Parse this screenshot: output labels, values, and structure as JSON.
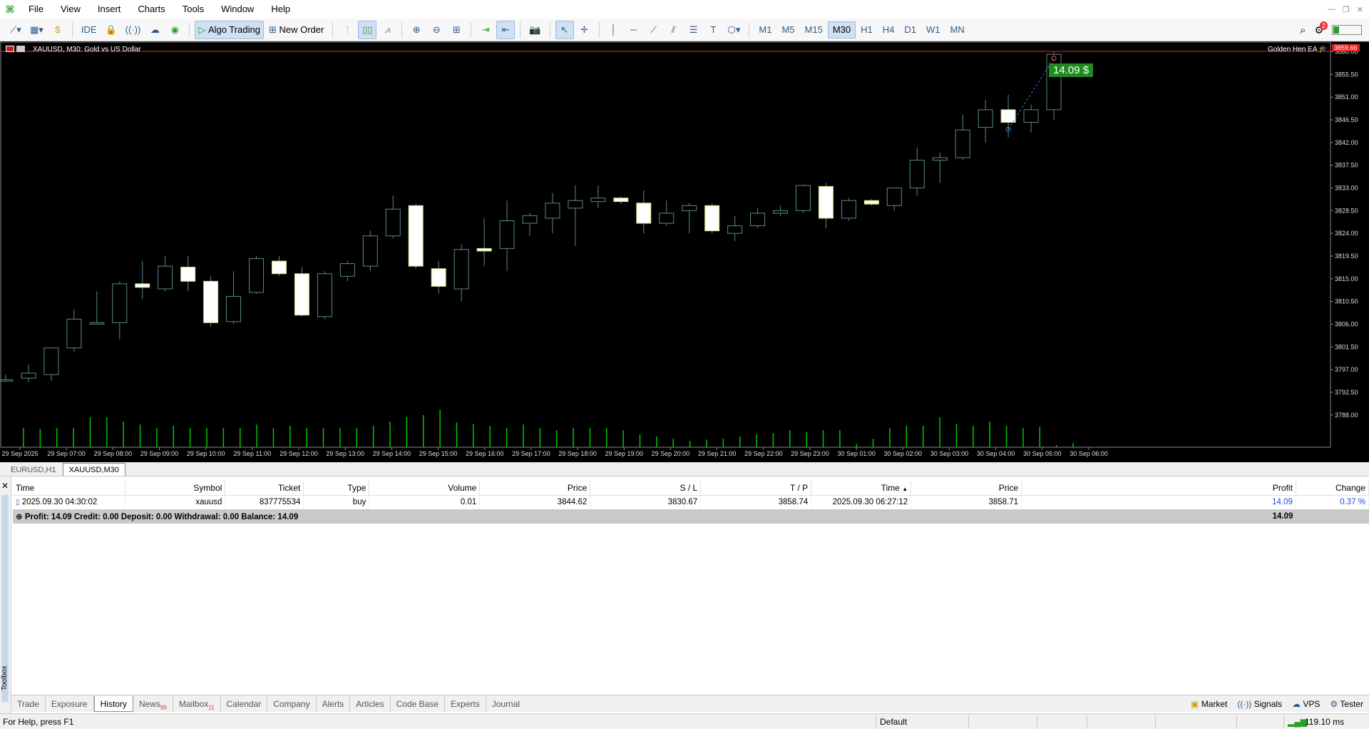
{
  "menubar": {
    "items": [
      "File",
      "View",
      "Insert",
      "Charts",
      "Tools",
      "Window",
      "Help"
    ]
  },
  "toolbar": {
    "ide_label": "IDE",
    "algo_trading_label": "Algo Trading",
    "new_order_label": "New Order",
    "timeframes": [
      "M1",
      "M5",
      "M15",
      "M30",
      "H1",
      "H4",
      "D1",
      "W1",
      "MN"
    ],
    "active_timeframe": "M30",
    "notification_count": "2"
  },
  "chart": {
    "symbol_title": "XAUUSD, M30:  Gold vs US Dollar",
    "ea_name": "Golden Hen EA",
    "profit_label": "14.09 $",
    "current_price_label": "3859.66",
    "colors": {
      "background": "#000000",
      "bull_body": "#000000",
      "bear_body": "#ffffff",
      "candle_outline": "#5a8a8a",
      "volume": "#00c800",
      "price_line": "#ff2020",
      "profit_bg": "#1f8a1f"
    }
  },
  "chart_data": {
    "type": "candlestick",
    "title": "XAUUSD, M30:  Gold vs US Dollar",
    "y_ticks": [
      "3860.00",
      "3855.50",
      "3851.00",
      "3846.50",
      "3842.00",
      "3837.50",
      "3833.00",
      "3828.50",
      "3824.00",
      "3819.50",
      "3815.00",
      "3810.50",
      "3806.00",
      "3801.50",
      "3797.00",
      "3792.50",
      "3788.00"
    ],
    "ylim": [
      3785.0,
      3860.5
    ],
    "x_ticks": [
      "29 Sep 2025",
      "29 Sep 07:00",
      "29 Sep 08:00",
      "29 Sep 09:00",
      "29 Sep 10:00",
      "29 Sep 11:00",
      "29 Sep 12:00",
      "29 Sep 13:00",
      "29 Sep 14:00",
      "29 Sep 15:00",
      "29 Sep 16:00",
      "29 Sep 17:00",
      "29 Sep 18:00",
      "29 Sep 19:00",
      "29 Sep 20:00",
      "29 Sep 21:00",
      "29 Sep 22:00",
      "29 Sep 23:00",
      "30 Sep 01:00",
      "30 Sep 02:00",
      "30 Sep 03:00",
      "30 Sep 04:00",
      "30 Sep 05:00",
      "30 Sep 06:00"
    ],
    "candles": [
      {
        "o": 3795.0,
        "h": 3796.0,
        "l": 3794.5,
        "c": 3795.0
      },
      {
        "o": 3795.3,
        "h": 3798.0,
        "l": 3794.5,
        "c": 3796.3
      },
      {
        "o": 3796.0,
        "h": 3801.3,
        "l": 3794.8,
        "c": 3801.3
      },
      {
        "o": 3801.3,
        "h": 3809.0,
        "l": 3800.5,
        "c": 3807.0
      },
      {
        "o": 3806.3,
        "h": 3812.5,
        "l": 3806.0,
        "c": 3806.3
      },
      {
        "o": 3806.3,
        "h": 3814.5,
        "l": 3803.0,
        "c": 3814.0
      },
      {
        "o": 3814.0,
        "h": 3818.5,
        "l": 3811.0,
        "c": 3813.3
      },
      {
        "o": 3813.0,
        "h": 3819.5,
        "l": 3812.5,
        "c": 3817.5
      },
      {
        "o": 3817.3,
        "h": 3819.5,
        "l": 3812.5,
        "c": 3814.5
      },
      {
        "o": 3814.5,
        "h": 3815.5,
        "l": 3805.5,
        "c": 3806.3
      },
      {
        "o": 3806.5,
        "h": 3816.5,
        "l": 3806.0,
        "c": 3811.5
      },
      {
        "o": 3812.3,
        "h": 3819.5,
        "l": 3812.0,
        "c": 3819.0
      },
      {
        "o": 3818.5,
        "h": 3819.5,
        "l": 3815.5,
        "c": 3816.0
      },
      {
        "o": 3816.0,
        "h": 3817.3,
        "l": 3807.5,
        "c": 3807.8
      },
      {
        "o": 3807.5,
        "h": 3816.5,
        "l": 3807.0,
        "c": 3816.0
      },
      {
        "o": 3815.5,
        "h": 3818.5,
        "l": 3814.5,
        "c": 3818.0
      },
      {
        "o": 3817.5,
        "h": 3824.5,
        "l": 3816.5,
        "c": 3823.5
      },
      {
        "o": 3823.5,
        "h": 3831.5,
        "l": 3823.0,
        "c": 3828.8
      },
      {
        "o": 3829.5,
        "h": 3829.8,
        "l": 3817.0,
        "c": 3817.5
      },
      {
        "o": 3817.0,
        "h": 3818.5,
        "l": 3812.0,
        "c": 3813.5
      },
      {
        "o": 3813.0,
        "h": 3821.8,
        "l": 3810.5,
        "c": 3820.8
      },
      {
        "o": 3821.0,
        "h": 3827.0,
        "l": 3817.5,
        "c": 3820.5
      },
      {
        "o": 3821.0,
        "h": 3830.5,
        "l": 3816.5,
        "c": 3826.5
      },
      {
        "o": 3826.0,
        "h": 3828.0,
        "l": 3823.5,
        "c": 3827.5
      },
      {
        "o": 3827.0,
        "h": 3832.0,
        "l": 3824.0,
        "c": 3830.0
      },
      {
        "o": 3829.0,
        "h": 3833.5,
        "l": 3821.5,
        "c": 3830.5
      },
      {
        "o": 3830.3,
        "h": 3833.5,
        "l": 3829.0,
        "c": 3831.0
      },
      {
        "o": 3831.0,
        "h": 3831.3,
        "l": 3829.8,
        "c": 3830.3
      },
      {
        "o": 3830.0,
        "h": 3832.5,
        "l": 3824.0,
        "c": 3826.0
      },
      {
        "o": 3826.0,
        "h": 3830.5,
        "l": 3825.5,
        "c": 3828.0
      },
      {
        "o": 3828.5,
        "h": 3830.0,
        "l": 3824.0,
        "c": 3829.5
      },
      {
        "o": 3829.5,
        "h": 3830.0,
        "l": 3824.0,
        "c": 3824.5
      },
      {
        "o": 3824.0,
        "h": 3827.5,
        "l": 3822.5,
        "c": 3825.5
      },
      {
        "o": 3825.5,
        "h": 3829.0,
        "l": 3825.0,
        "c": 3828.0
      },
      {
        "o": 3828.0,
        "h": 3829.5,
        "l": 3827.5,
        "c": 3828.5
      },
      {
        "o": 3828.5,
        "h": 3833.7,
        "l": 3828.0,
        "c": 3833.5
      },
      {
        "o": 3833.3,
        "h": 3834.0,
        "l": 3825.0,
        "c": 3827.0
      },
      {
        "o": 3827.0,
        "h": 3831.0,
        "l": 3826.5,
        "c": 3830.5
      },
      {
        "o": 3830.5,
        "h": 3830.8,
        "l": 3829.5,
        "c": 3829.8
      },
      {
        "o": 3829.5,
        "h": 3833.0,
        "l": 3828.5,
        "c": 3833.0
      },
      {
        "o": 3833.0,
        "h": 3841.0,
        "l": 3831.5,
        "c": 3838.5
      },
      {
        "o": 3838.5,
        "h": 3840.0,
        "l": 3834.0,
        "c": 3839.0
      },
      {
        "o": 3839.0,
        "h": 3847.5,
        "l": 3838.5,
        "c": 3844.5
      },
      {
        "o": 3845.0,
        "h": 3850.5,
        "l": 3842.0,
        "c": 3848.5
      },
      {
        "o": 3848.5,
        "h": 3851.5,
        "l": 3843.0,
        "c": 3846.0
      },
      {
        "o": 3846.0,
        "h": 3849.5,
        "l": 3844.0,
        "c": 3848.5
      },
      {
        "o": 3848.5,
        "h": 3860.0,
        "l": 3846.5,
        "c": 3859.5
      }
    ],
    "volumes": [
      0.45,
      0.43,
      0.45,
      0.45,
      0.7,
      0.7,
      0.6,
      0.53,
      0.45,
      0.5,
      0.45,
      0.45,
      0.45,
      0.45,
      0.53,
      0.45,
      0.5,
      0.45,
      0.45,
      0.45,
      0.45,
      0.5,
      0.6,
      0.7,
      0.75,
      0.88,
      0.58,
      0.54,
      0.5,
      0.45,
      0.53,
      0.45,
      0.4,
      0.45,
      0.45,
      0.45,
      0.4,
      0.3,
      0.25,
      0.2,
      0.15,
      0.18,
      0.2,
      0.25,
      0.3,
      0.33,
      0.4,
      0.35,
      0.4,
      0.4,
      0.08,
      0.2,
      0.45,
      0.5,
      0.5,
      0.7,
      0.55,
      0.5,
      0.6,
      0.5,
      0.45,
      0.48,
      0.05,
      0.1
    ],
    "trade": {
      "entry_price": 3844.62,
      "exit_price": 3858.71
    }
  },
  "chart_tabs": [
    "EURUSD,H1",
    "XAUUSD,M30"
  ],
  "history": {
    "columns": [
      "Time",
      "Symbol",
      "Ticket",
      "Type",
      "Volume",
      "Price",
      "S / L",
      "T / P",
      "Time",
      "Price",
      "Profit",
      "Change"
    ],
    "rows": [
      {
        "time": "2025.09.30 04:30:02",
        "symbol": "xauusd",
        "ticket": "837775534",
        "type": "buy",
        "volume": "0.01",
        "price": "3844.62",
        "sl": "3830.67",
        "tp": "3858.74",
        "close_time": "2025.09.30 06:27:12",
        "close_price": "3858.71",
        "profit": "14.09",
        "change": "0.37 %"
      }
    ],
    "summary": "Profit: 14.09  Credit: 0.00  Deposit: 0.00  Withdrawal: 0.00  Balance: 14.09",
    "summary_profit": "14.09"
  },
  "toolbox": {
    "label": "Toolbox",
    "tabs": [
      {
        "label": "Trade",
        "count": ""
      },
      {
        "label": "Exposure",
        "count": ""
      },
      {
        "label": "History",
        "count": ""
      },
      {
        "label": "News",
        "count": "99"
      },
      {
        "label": "Mailbox",
        "count": "11"
      },
      {
        "label": "Calendar",
        "count": ""
      },
      {
        "label": "Company",
        "count": ""
      },
      {
        "label": "Alerts",
        "count": ""
      },
      {
        "label": "Articles",
        "count": ""
      },
      {
        "label": "Code Base",
        "count": ""
      },
      {
        "label": "Experts",
        "count": ""
      },
      {
        "label": "Journal",
        "count": ""
      }
    ],
    "active_tab": "History",
    "right_buttons": [
      "Market",
      "Signals",
      "VPS",
      "Tester"
    ]
  },
  "statusbar": {
    "help_text": "For Help, press F1",
    "profile": "Default",
    "ping": "119.10 ms"
  }
}
